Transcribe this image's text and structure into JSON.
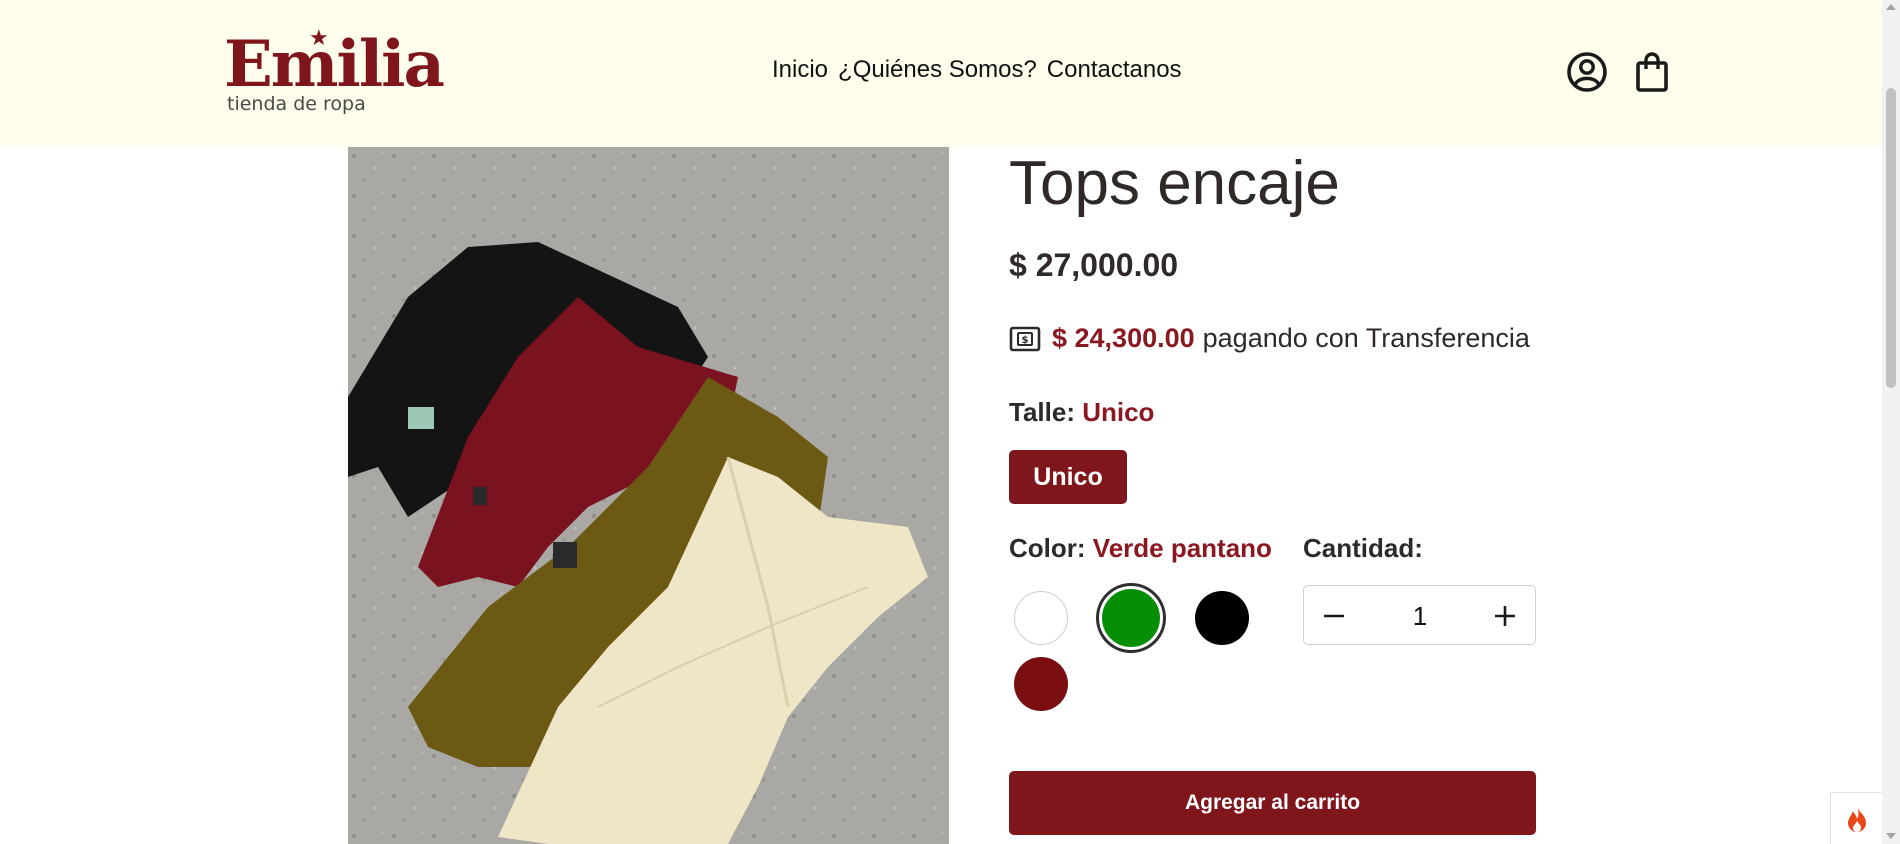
{
  "brand": {
    "name": "Emilia",
    "tagline": "tienda de ropa",
    "color": "#7f161c"
  },
  "nav": {
    "items": [
      {
        "label": "Inicio"
      },
      {
        "label": "¿Quiénes Somos?"
      },
      {
        "label": "Contactanos"
      }
    ]
  },
  "header_icons": {
    "account": "user-circle-icon",
    "cart": "shopping-bag-icon"
  },
  "product": {
    "title": "Tops encaje",
    "price": "$ 27,000.00",
    "transfer_price": "$ 24,300.00",
    "transfer_text": "pagando con Transferencia",
    "size_label": "Talle:",
    "size_selected": "Unico",
    "size_options": [
      "Unico"
    ],
    "color_label": "Color:",
    "color_selected": "Verde pantano",
    "colors": [
      {
        "hex": "#ffffff",
        "selected": false
      },
      {
        "hex": "#068e06",
        "selected": true
      },
      {
        "hex": "#000000",
        "selected": false
      },
      {
        "hex": "#7a0e10",
        "selected": false
      }
    ],
    "quantity_label": "Cantidad:",
    "quantity_value": "1",
    "add_to_cart_label": "Agregar al carrito"
  },
  "colors": {
    "accent": "#7f161c",
    "header_bg": "#fffdec",
    "text": "#2f2a28"
  }
}
